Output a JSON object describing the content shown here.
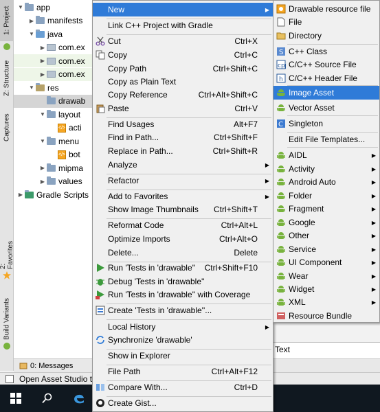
{
  "strip": {
    "project_tab": "1: Project",
    "structure_tab": "Z: Structure",
    "captures_tab": "Captures",
    "favorites_tab": "2: Favorites",
    "build_variants_tab": "Build Variants"
  },
  "tree": {
    "rows": [
      {
        "label": "app",
        "kind": "folder",
        "arrow": "▼"
      },
      {
        "label": "manifests",
        "kind": "folder",
        "arrow": "▶"
      },
      {
        "label": "java",
        "kind": "folder-java",
        "arrow": "▼"
      },
      {
        "label": "com.ex",
        "kind": "pkg",
        "arrow": "▶"
      },
      {
        "label": "com.ex",
        "kind": "pkg",
        "arrow": "▶"
      },
      {
        "label": "com.ex",
        "kind": "pkg",
        "arrow": "▶"
      },
      {
        "label": "res",
        "kind": "folder-res",
        "arrow": "▼"
      },
      {
        "label": "drawab",
        "kind": "folder",
        "arrow": ""
      },
      {
        "label": "layout",
        "kind": "folder",
        "arrow": "▼"
      },
      {
        "label": "acti",
        "kind": "xml",
        "arrow": ""
      },
      {
        "label": "menu",
        "kind": "folder",
        "arrow": "▼"
      },
      {
        "label": "bot",
        "kind": "xml",
        "arrow": ""
      },
      {
        "label": "mipma",
        "kind": "folder",
        "arrow": "▶"
      },
      {
        "label": "values",
        "kind": "folder",
        "arrow": "▶"
      },
      {
        "label": "Gradle Scripts",
        "kind": "gradle",
        "arrow": "▶"
      }
    ]
  },
  "main_menu": {
    "items": [
      {
        "label": "New",
        "shortcut": "",
        "submenu": true,
        "highlighted": true,
        "icon": ""
      },
      {
        "label": "Link C++ Project with Gradle",
        "shortcut": "",
        "submenu": false,
        "icon": ""
      },
      {
        "label": "Cut",
        "shortcut": "Ctrl+X",
        "submenu": false,
        "icon": "scissors-icon"
      },
      {
        "label": "Copy",
        "shortcut": "Ctrl+C",
        "submenu": false,
        "icon": "copy-icon"
      },
      {
        "label": "Copy Path",
        "shortcut": "Ctrl+Shift+C",
        "submenu": false,
        "icon": ""
      },
      {
        "label": "Copy as Plain Text",
        "shortcut": "",
        "submenu": false,
        "icon": ""
      },
      {
        "label": "Copy Reference",
        "shortcut": "Ctrl+Alt+Shift+C",
        "submenu": false,
        "icon": ""
      },
      {
        "label": "Paste",
        "shortcut": "Ctrl+V",
        "submenu": false,
        "icon": "paste-icon"
      },
      {
        "label": "Find Usages",
        "shortcut": "Alt+F7",
        "submenu": false,
        "icon": ""
      },
      {
        "label": "Find in Path...",
        "shortcut": "Ctrl+Shift+F",
        "submenu": false,
        "icon": ""
      },
      {
        "label": "Replace in Path...",
        "shortcut": "Ctrl+Shift+R",
        "submenu": false,
        "icon": ""
      },
      {
        "label": "Analyze",
        "shortcut": "",
        "submenu": true,
        "icon": ""
      },
      {
        "label": "Refactor",
        "shortcut": "",
        "submenu": true,
        "icon": ""
      },
      {
        "label": "Add to Favorites",
        "shortcut": "",
        "submenu": true,
        "icon": ""
      },
      {
        "label": "Show Image Thumbnails",
        "shortcut": "Ctrl+Shift+T",
        "submenu": false,
        "icon": ""
      },
      {
        "label": "Reformat Code",
        "shortcut": "Ctrl+Alt+L",
        "submenu": false,
        "icon": ""
      },
      {
        "label": "Optimize Imports",
        "shortcut": "Ctrl+Alt+O",
        "submenu": false,
        "icon": ""
      },
      {
        "label": "Delete...",
        "shortcut": "Delete",
        "submenu": false,
        "icon": ""
      },
      {
        "label": "Run 'Tests in 'drawable''",
        "shortcut": "Ctrl+Shift+F10",
        "submenu": false,
        "icon": "run-icon"
      },
      {
        "label": "Debug 'Tests in 'drawable''",
        "shortcut": "",
        "submenu": false,
        "icon": "debug-icon"
      },
      {
        "label": "Run 'Tests in 'drawable'' with Coverage",
        "shortcut": "",
        "submenu": false,
        "icon": "coverage-icon"
      },
      {
        "label": "Create 'Tests in 'drawable''...",
        "shortcut": "",
        "submenu": false,
        "icon": "create-test-icon"
      },
      {
        "label": "Local History",
        "shortcut": "",
        "submenu": true,
        "icon": ""
      },
      {
        "label": "Synchronize 'drawable'",
        "shortcut": "",
        "submenu": false,
        "icon": "sync-icon"
      },
      {
        "label": "Show in Explorer",
        "shortcut": "",
        "submenu": false,
        "icon": ""
      },
      {
        "label": "File Path",
        "shortcut": "Ctrl+Alt+F12",
        "submenu": false,
        "icon": ""
      },
      {
        "label": "Compare With...",
        "shortcut": "Ctrl+D",
        "submenu": false,
        "icon": "compare-icon"
      },
      {
        "label": "Create Gist...",
        "shortcut": "",
        "submenu": false,
        "icon": "github-icon"
      }
    ]
  },
  "new_menu": {
    "items": [
      {
        "label": "Drawable resource file",
        "submenu": false,
        "icon": "drawable-file-icon"
      },
      {
        "label": "File",
        "submenu": false,
        "icon": "file-icon"
      },
      {
        "label": "Directory",
        "submenu": false,
        "icon": "folder-icon"
      },
      {
        "label": "C++ Class",
        "submenu": false,
        "icon": "cpp-class-icon"
      },
      {
        "label": "C/C++ Source File",
        "submenu": false,
        "icon": "cpp-source-icon"
      },
      {
        "label": "C/C++ Header File",
        "submenu": false,
        "icon": "cpp-header-icon"
      },
      {
        "label": "Image Asset",
        "submenu": false,
        "icon": "android-icon",
        "highlighted": true
      },
      {
        "label": "Vector Asset",
        "submenu": false,
        "icon": "android-icon"
      },
      {
        "label": "Singleton",
        "submenu": false,
        "icon": "singleton-icon"
      },
      {
        "label": "Edit File Templates...",
        "submenu": false,
        "icon": ""
      },
      {
        "label": "AIDL",
        "submenu": true,
        "icon": "android-icon"
      },
      {
        "label": "Activity",
        "submenu": true,
        "icon": "android-icon"
      },
      {
        "label": "Android Auto",
        "submenu": true,
        "icon": "android-icon"
      },
      {
        "label": "Folder",
        "submenu": true,
        "icon": "android-icon"
      },
      {
        "label": "Fragment",
        "submenu": true,
        "icon": "android-icon"
      },
      {
        "label": "Google",
        "submenu": true,
        "icon": "android-icon"
      },
      {
        "label": "Other",
        "submenu": true,
        "icon": "android-icon"
      },
      {
        "label": "Service",
        "submenu": true,
        "icon": "android-icon"
      },
      {
        "label": "UI Component",
        "submenu": true,
        "icon": "android-icon"
      },
      {
        "label": "Wear",
        "submenu": true,
        "icon": "android-icon"
      },
      {
        "label": "Widget",
        "submenu": true,
        "icon": "android-icon"
      },
      {
        "label": "XML",
        "submenu": true,
        "icon": "android-icon"
      },
      {
        "label": "Resource Bundle",
        "submenu": false,
        "icon": "resource-bundle-icon"
      }
    ]
  },
  "editor": {
    "tab_label": "Text"
  },
  "toolwindow": {
    "messages_label": "0: Messages"
  },
  "statusbar": {
    "text": "Open Asset Studio to"
  },
  "colors": {
    "highlight": "#2f7bd8",
    "android_green": "#78b33d",
    "taskbar": "#101820"
  }
}
